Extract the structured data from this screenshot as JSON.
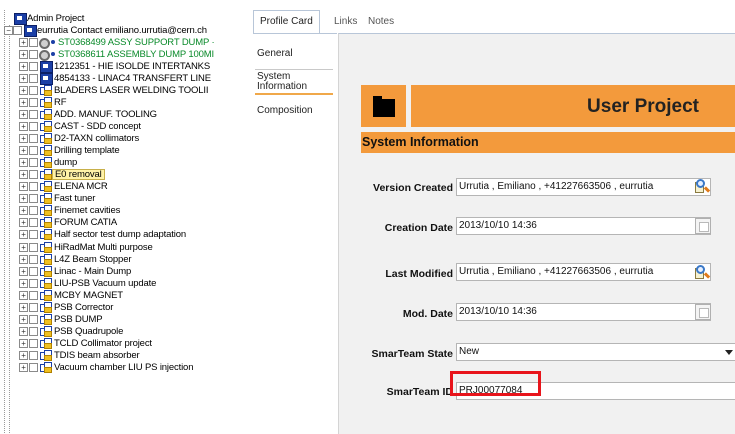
{
  "tree": {
    "root": "Admin Project",
    "contact": "eurrutia Contact emiliano.urrutia@cern.ch",
    "items": [
      {
        "label": "ST0368499 ASSY SUPPORT DUMP ·",
        "kind": "doc",
        "green": true
      },
      {
        "label": "ST0368611 ASSEMBLY DUMP 100MI",
        "kind": "doc",
        "green": true
      },
      {
        "label": "1212351 - HIE ISOLDE INTERTANKS",
        "kind": "proj"
      },
      {
        "label": "4854133 - LINAC4 TRANSFERT LINE",
        "kind": "proj"
      },
      {
        "label": "BLADERS LASER WELDING TOOLII",
        "kind": "folder"
      },
      {
        "label": "RF",
        "kind": "folder"
      },
      {
        "label": "ADD. MANUF. TOOLING",
        "kind": "folder"
      },
      {
        "label": "CAST - SDD concept",
        "kind": "folder"
      },
      {
        "label": "D2-TAXN collimators",
        "kind": "folder"
      },
      {
        "label": "Drilling template",
        "kind": "folder"
      },
      {
        "label": "dump",
        "kind": "folder"
      },
      {
        "label": "E0 removal",
        "kind": "folder",
        "highlight": true
      },
      {
        "label": "ELENA MCR",
        "kind": "folder"
      },
      {
        "label": "Fast tuner",
        "kind": "folder"
      },
      {
        "label": "Finemet cavities",
        "kind": "folder"
      },
      {
        "label": "FORUM CATIA",
        "kind": "folder"
      },
      {
        "label": "Half sector test dump adaptation",
        "kind": "folder"
      },
      {
        "label": "HiRadMat Multi purpose",
        "kind": "folder"
      },
      {
        "label": "L4Z Beam Stopper",
        "kind": "folder"
      },
      {
        "label": "Linac - Main Dump",
        "kind": "folder"
      },
      {
        "label": "LIU-PSB Vacuum update",
        "kind": "folder"
      },
      {
        "label": "MCBY MAGNET",
        "kind": "folder"
      },
      {
        "label": "PSB Corrector",
        "kind": "folder"
      },
      {
        "label": "PSB DUMP",
        "kind": "folder"
      },
      {
        "label": "PSB Quadrupole",
        "kind": "folder"
      },
      {
        "label": "TCLD Collimator project",
        "kind": "folder"
      },
      {
        "label": "TDIS beam absorber",
        "kind": "folder"
      },
      {
        "label": "Vacuum chamber LIU PS injection",
        "kind": "folder"
      }
    ]
  },
  "tabs": [
    "Profile Card",
    "Links",
    "Notes"
  ],
  "nav": [
    "General",
    "System Information",
    "Composition"
  ],
  "banner_title": "User Project",
  "section_title": "System Information",
  "fields": {
    "version_created_label": "Version Created",
    "version_created": "Urrutia , Emiliano , +41227663506 , eurrutia",
    "creation_date_label": "Creation Date",
    "creation_date": "2013/10/10 14:36",
    "last_modified_label": "Last Modified",
    "last_modified": "Urrutia , Emiliano , +41227663506 , eurrutia",
    "mod_date_label": "Mod. Date",
    "mod_date": "2013/10/10 14:36",
    "state_label": "SmarTeam State",
    "state": "New",
    "id_label": "SmarTeam ID",
    "id": "PRJ00077084"
  },
  "colors": {
    "accent_orange": "#f39a3c",
    "highlight_red": "#e8141b"
  }
}
